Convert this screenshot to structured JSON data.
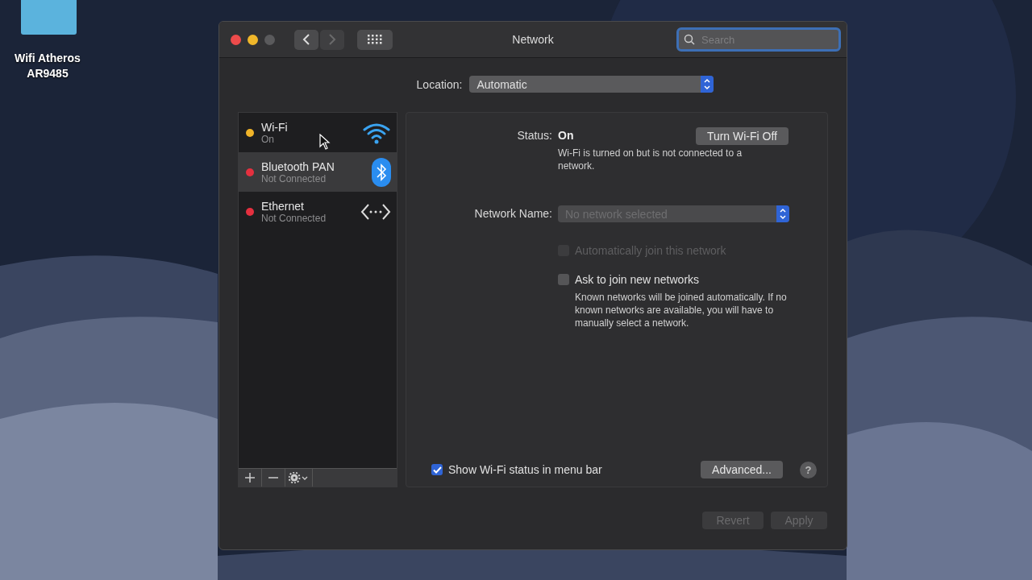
{
  "desktop_icon": {
    "lines": [
      "Wifi Atheros",
      "AR9485"
    ]
  },
  "window": {
    "title": "Network",
    "search": {
      "placeholder": "Search"
    }
  },
  "location": {
    "label": "Location:",
    "value": "Automatic"
  },
  "services": [
    {
      "name": "Wi-Fi",
      "status": "On",
      "color": "#f0b429",
      "selected": false,
      "kind": "wifi"
    },
    {
      "name": "Bluetooth PAN",
      "status": "Not Connected",
      "color": "#e5303f",
      "selected": true,
      "kind": "bluetooth"
    },
    {
      "name": "Ethernet",
      "status": "Not Connected",
      "color": "#e5303f",
      "selected": false,
      "kind": "ethernet"
    }
  ],
  "detail": {
    "status_label": "Status:",
    "status_value": "On",
    "toggle_button": "Turn Wi-Fi Off",
    "status_note": "Wi-Fi is turned on but is not connected to a network.",
    "network_name_label": "Network Name:",
    "network_name": {
      "value": "No network selected",
      "disabled": true
    },
    "options": [
      {
        "label": "Automatically join this network",
        "checked": false,
        "disabled": true
      },
      {
        "label": "Ask to join new networks",
        "checked": false,
        "disabled": false,
        "note": "Known networks will be joined automatically. If no known networks are available, you will have to manually select a network."
      }
    ],
    "show_status": {
      "label": "Show Wi-Fi status in menu bar",
      "checked": true
    },
    "advanced_button": "Advanced...",
    "help_button": "?"
  },
  "footer_buttons": [
    {
      "label": "Revert",
      "disabled": true
    },
    {
      "label": "Apply",
      "disabled": true
    }
  ]
}
